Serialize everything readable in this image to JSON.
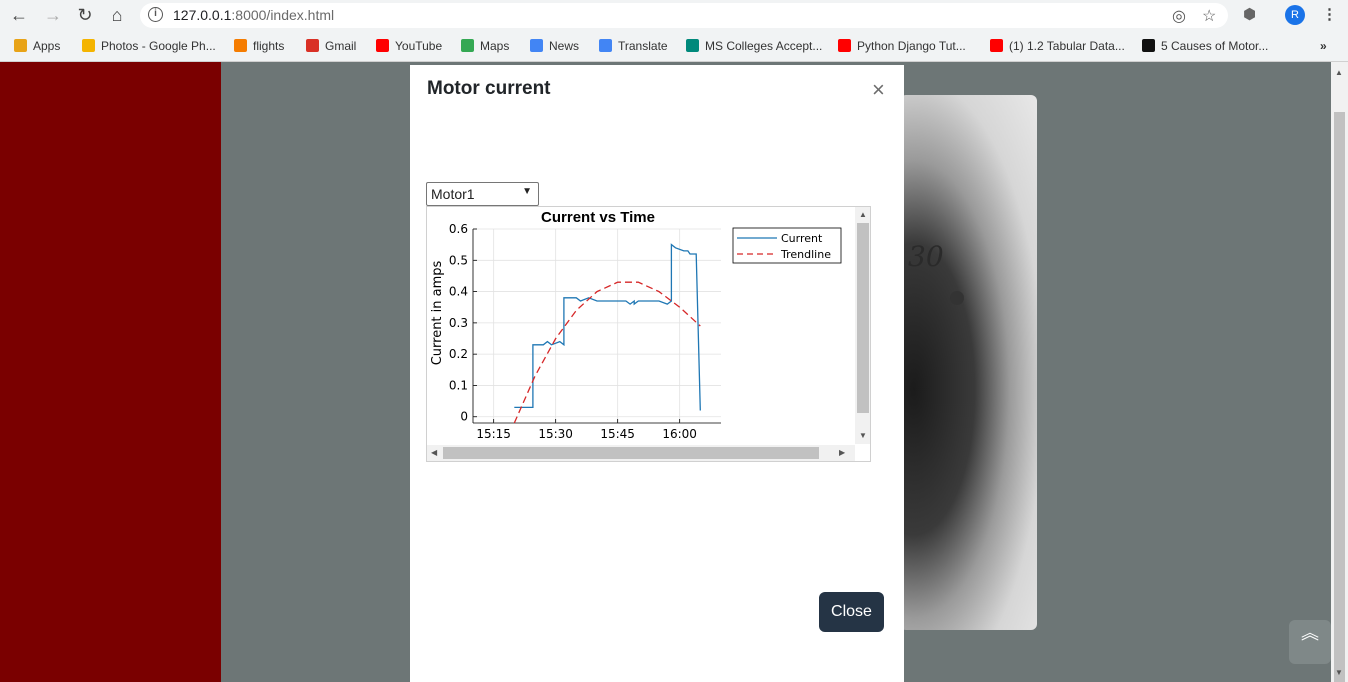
{
  "browser": {
    "url_host": "127.0.0.1",
    "url_rest": ":8000/index.html",
    "avatar_initial": "R",
    "bookmarks": [
      {
        "label": "Apps",
        "color": "#e8a317"
      },
      {
        "label": "Photos - Google Ph...",
        "color": "#f4b400"
      },
      {
        "label": "flights",
        "color": "#f57c00"
      },
      {
        "label": "Gmail",
        "color": "#d93025"
      },
      {
        "label": "YouTube",
        "color": "#ff0000"
      },
      {
        "label": "Maps",
        "color": "#34a853"
      },
      {
        "label": "News",
        "color": "#4285f4"
      },
      {
        "label": "Translate",
        "color": "#4285f4"
      },
      {
        "label": "MS Colleges Accept...",
        "color": "#00897b"
      },
      {
        "label": "Python Django Tut...",
        "color": "#ff0000"
      },
      {
        "label": "(1) 1.2 Tabular Data...",
        "color": "#ff0000"
      },
      {
        "label": "5 Causes of Motor...",
        "color": "#111111"
      }
    ],
    "more_bookmarks": "»"
  },
  "page": {
    "photo_number": "30",
    "scroll_top_icon": "double-chevron-up"
  },
  "modal": {
    "title": "Motor current",
    "close_x": "×",
    "selected_motor": "Motor1",
    "close_label": "Close"
  },
  "chart_data": {
    "type": "line",
    "title": "Current vs Time",
    "xlabel": "",
    "ylabel": "Current in  amps",
    "x_ticks": [
      "15:15",
      "15:30",
      "15:45",
      "16:00"
    ],
    "y_ticks": [
      "0",
      "0.1",
      "0.2",
      "0.3",
      "0.4",
      "0.5",
      "0.6"
    ],
    "xlim": [
      "15:10",
      "16:10"
    ],
    "ylim": [
      -0.02,
      0.6
    ],
    "grid": true,
    "legend_position": "top-right",
    "series": [
      {
        "name": "Current",
        "color": "#1f77b4",
        "style": "solid",
        "x": [
          "15:20",
          "15:24.5",
          "15:24.5",
          "15:27",
          "15:28",
          "15:29",
          "15:31",
          "15:32",
          "15:32",
          "15:35",
          "15:36",
          "15:38",
          "15:40",
          "15:45",
          "15:47",
          "15:48",
          "15:49",
          "15:49",
          "15:50",
          "15:53",
          "15:55",
          "15:57",
          "15:58",
          "15:58",
          "15:59",
          "16:01",
          "16:02",
          "16:02.5",
          "16:04",
          "16:05"
        ],
        "y": [
          0.03,
          0.03,
          0.23,
          0.23,
          0.24,
          0.23,
          0.24,
          0.23,
          0.38,
          0.38,
          0.37,
          0.38,
          0.37,
          0.37,
          0.37,
          0.36,
          0.37,
          0.36,
          0.37,
          0.37,
          0.37,
          0.36,
          0.37,
          0.55,
          0.54,
          0.53,
          0.53,
          0.52,
          0.52,
          0.02
        ]
      },
      {
        "name": "Trendline",
        "color": "#d62728",
        "style": "dashed",
        "x": [
          "15:20",
          "15:25",
          "15:30",
          "15:35",
          "15:40",
          "15:45",
          "15:50",
          "15:55",
          "16:00",
          "16:05"
        ],
        "y": [
          -0.02,
          0.13,
          0.25,
          0.34,
          0.4,
          0.43,
          0.43,
          0.4,
          0.35,
          0.29
        ]
      }
    ]
  }
}
